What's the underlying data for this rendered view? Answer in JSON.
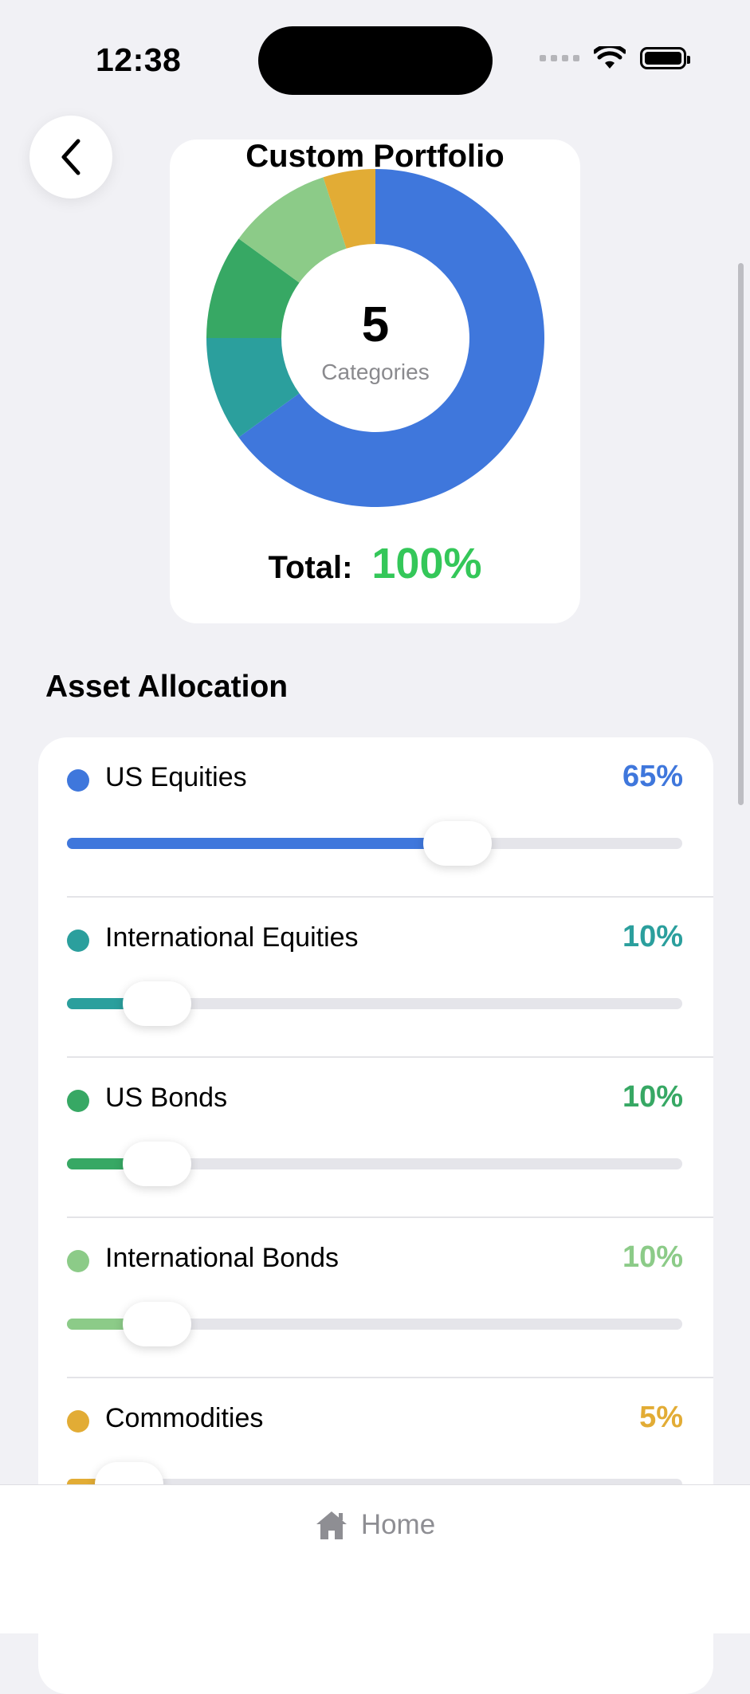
{
  "status_bar": {
    "time": "12:38"
  },
  "header": {
    "title": "Custom Portfolio",
    "back_icon": "chevron-left-icon"
  },
  "summary": {
    "category_count": "5",
    "category_label": "Categories",
    "total_label": "Total:",
    "total_value": "100%"
  },
  "section": {
    "title": "Asset Allocation"
  },
  "allocations": [
    {
      "name": "US Equities",
      "percent_label": "65%",
      "value": 65,
      "color": "#3f77dc"
    },
    {
      "name": "International Equities",
      "percent_label": "10%",
      "value": 10,
      "color": "#2b9f9d"
    },
    {
      "name": "US Bonds",
      "percent_label": "10%",
      "value": 10,
      "color": "#37a864"
    },
    {
      "name": "International Bonds",
      "percent_label": "10%",
      "value": 10,
      "color": "#8ccb88"
    },
    {
      "name": "Commodities",
      "percent_label": "5%",
      "value": 5,
      "color": "#e2ac35"
    }
  ],
  "chart_data": {
    "type": "pie",
    "categories": [
      "US Equities",
      "International Equities",
      "US Bonds",
      "International Bonds",
      "Commodities"
    ],
    "values": [
      65,
      10,
      10,
      10,
      5
    ],
    "colors": [
      "#3f77dc",
      "#2b9f9d",
      "#37a864",
      "#8ccb88",
      "#e2ac35"
    ]
  },
  "tab_bar": {
    "home_label": "Home",
    "home_icon": "house-icon"
  }
}
